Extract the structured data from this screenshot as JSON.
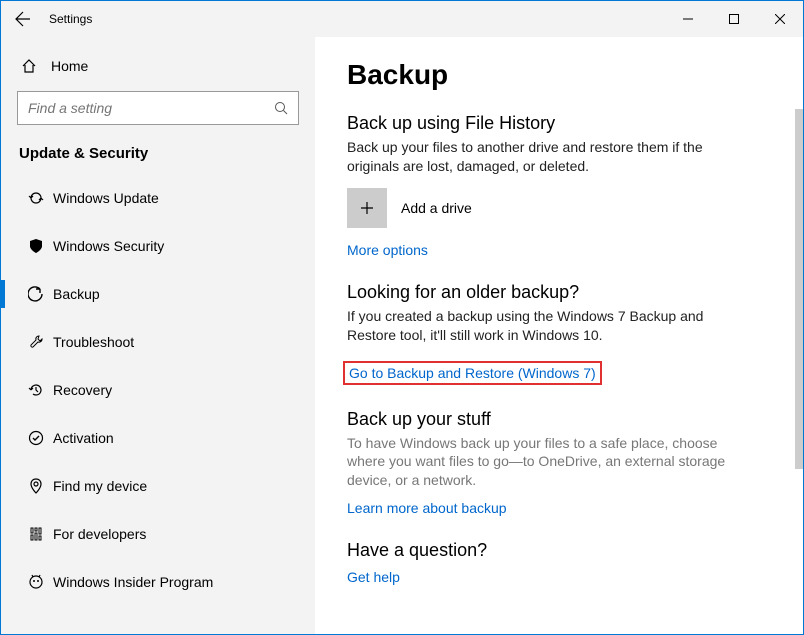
{
  "titlebar": {
    "app_name": "Settings"
  },
  "sidebar": {
    "home_label": "Home",
    "search_placeholder": "Find a setting",
    "section_title": "Update & Security",
    "items": [
      {
        "label": "Windows Update"
      },
      {
        "label": "Windows Security"
      },
      {
        "label": "Backup"
      },
      {
        "label": "Troubleshoot"
      },
      {
        "label": "Recovery"
      },
      {
        "label": "Activation"
      },
      {
        "label": "Find my device"
      },
      {
        "label": "For developers"
      },
      {
        "label": "Windows Insider Program"
      }
    ]
  },
  "main": {
    "page_title": "Backup",
    "file_history": {
      "heading": "Back up using File History",
      "body": "Back up your files to another drive and restore them if the originals are lost, damaged, or deleted.",
      "add_drive_label": "Add a drive",
      "more_options_link": "More options"
    },
    "older_backup": {
      "heading": "Looking for an older backup?",
      "body": "If you created a backup using the Windows 7 Backup and Restore tool, it'll still work in Windows 10.",
      "link": "Go to Backup and Restore (Windows 7)"
    },
    "stuff": {
      "heading": "Back up your stuff",
      "body": "To have Windows back up your files to a safe place, choose where you want files to go—to OneDrive, an external storage device, or a network.",
      "link": "Learn more about backup"
    },
    "question": {
      "heading": "Have a question?",
      "link": "Get help"
    }
  }
}
